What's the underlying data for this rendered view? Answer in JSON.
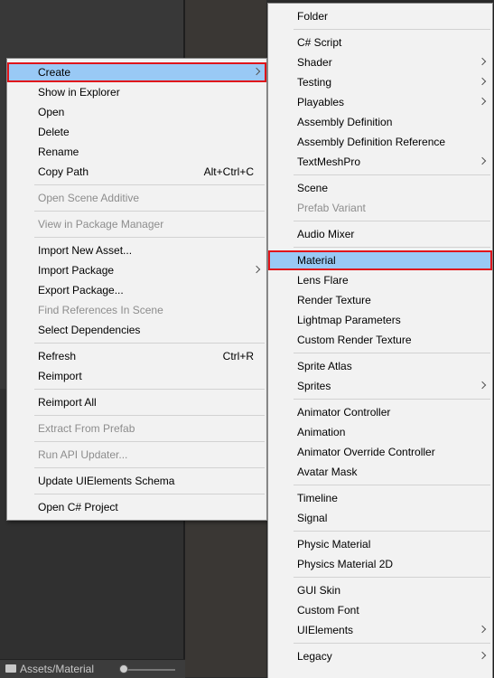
{
  "status_bar": {
    "path": "Assets/Material"
  },
  "main_menu": {
    "items": [
      {
        "label": "Create",
        "submenu": true,
        "highlight": true
      },
      {
        "label": "Show in Explorer"
      },
      {
        "label": "Open"
      },
      {
        "label": "Delete"
      },
      {
        "label": "Rename"
      },
      {
        "label": "Copy Path",
        "shortcut": "Alt+Ctrl+C"
      },
      {
        "separator": true
      },
      {
        "label": "Open Scene Additive",
        "disabled": true
      },
      {
        "separator": true
      },
      {
        "label": "View in Package Manager",
        "disabled": true
      },
      {
        "separator": true
      },
      {
        "label": "Import New Asset..."
      },
      {
        "label": "Import Package",
        "submenu": true
      },
      {
        "label": "Export Package..."
      },
      {
        "label": "Find References In Scene",
        "disabled": true
      },
      {
        "label": "Select Dependencies"
      },
      {
        "separator": true
      },
      {
        "label": "Refresh",
        "shortcut": "Ctrl+R"
      },
      {
        "label": "Reimport"
      },
      {
        "separator": true
      },
      {
        "label": "Reimport All"
      },
      {
        "separator": true
      },
      {
        "label": "Extract From Prefab",
        "disabled": true
      },
      {
        "separator": true
      },
      {
        "label": "Run API Updater...",
        "disabled": true
      },
      {
        "separator": true
      },
      {
        "label": "Update UIElements Schema"
      },
      {
        "separator": true
      },
      {
        "label": "Open C# Project"
      }
    ]
  },
  "create_submenu": {
    "items": [
      {
        "label": "Folder"
      },
      {
        "separator": true
      },
      {
        "label": "C# Script"
      },
      {
        "label": "Shader",
        "submenu": true
      },
      {
        "label": "Testing",
        "submenu": true
      },
      {
        "label": "Playables",
        "submenu": true
      },
      {
        "label": "Assembly Definition"
      },
      {
        "label": "Assembly Definition Reference"
      },
      {
        "label": "TextMeshPro",
        "submenu": true
      },
      {
        "separator": true
      },
      {
        "label": "Scene"
      },
      {
        "label": "Prefab Variant",
        "disabled": true
      },
      {
        "separator": true
      },
      {
        "label": "Audio Mixer"
      },
      {
        "separator": true
      },
      {
        "label": "Material",
        "highlight": true
      },
      {
        "label": "Lens Flare"
      },
      {
        "label": "Render Texture"
      },
      {
        "label": "Lightmap Parameters"
      },
      {
        "label": "Custom Render Texture"
      },
      {
        "separator": true
      },
      {
        "label": "Sprite Atlas"
      },
      {
        "label": "Sprites",
        "submenu": true
      },
      {
        "separator": true
      },
      {
        "label": "Animator Controller"
      },
      {
        "label": "Animation"
      },
      {
        "label": "Animator Override Controller"
      },
      {
        "label": "Avatar Mask"
      },
      {
        "separator": true
      },
      {
        "label": "Timeline"
      },
      {
        "label": "Signal"
      },
      {
        "separator": true
      },
      {
        "label": "Physic Material"
      },
      {
        "label": "Physics Material 2D"
      },
      {
        "separator": true
      },
      {
        "label": "GUI Skin"
      },
      {
        "label": "Custom Font"
      },
      {
        "label": "UIElements",
        "submenu": true
      },
      {
        "separator": true
      },
      {
        "label": "Legacy",
        "submenu": true
      }
    ]
  },
  "colors": {
    "menu_bg": "#f2f2f2",
    "highlight": "#99c9f5",
    "callout_outline": "#e0151b",
    "disabled_text": "#8d8d8d"
  }
}
